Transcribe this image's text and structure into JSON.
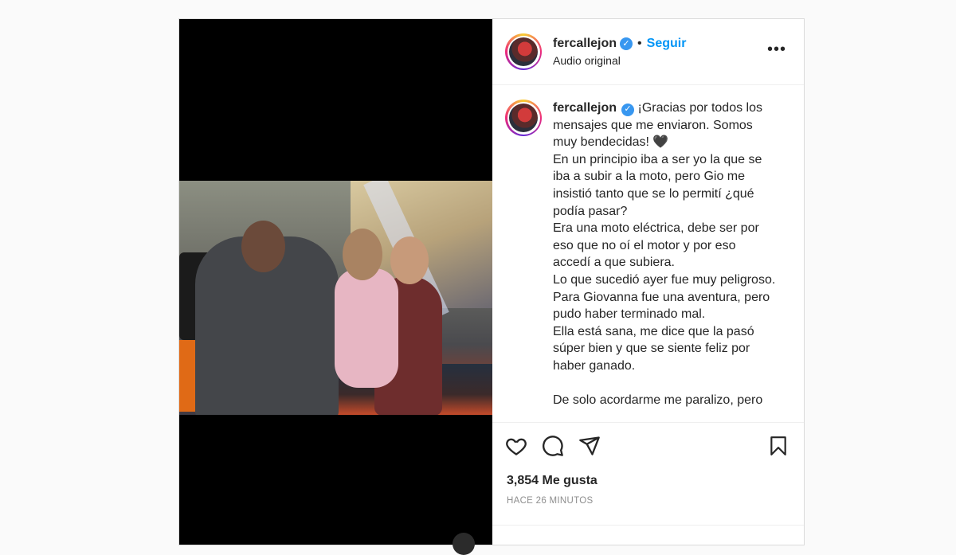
{
  "post": {
    "header": {
      "username": "fercallejon",
      "verified_icon": "verified-badge-icon",
      "separator": "•",
      "follow_label": "Seguir",
      "audio_label": "Audio original",
      "more_label": "•••"
    },
    "caption": {
      "username": "fercallejon",
      "lines": [
        "¡Gracias por todos los mensajes que me enviaron. Somos muy bendecidas! 🖤",
        "En un principio iba a ser yo la que se iba a subir a la moto, pero Gio me insistió tanto que se lo permití ¿qué podía pasar?",
        "Era una moto eléctrica, debe ser por eso que no oí el motor y por eso accedí a que subiera.",
        "Lo que sucedió ayer fue muy peligroso. Para Giovanna fue una aventura, pero pudo haber terminado mal.",
        "Ella está sana, me dice que la pasó súper bien y que se siente feliz por haber ganado.",
        "",
        "De solo acordarme me paralizo, pero"
      ]
    },
    "actions": {
      "like_icon": "heart-icon",
      "comment_icon": "comment-icon",
      "share_icon": "share-icon",
      "save_icon": "bookmark-icon"
    },
    "likes_text": "3,854 Me gusta",
    "time_text": "HACE 26 MINUTOS"
  },
  "colors": {
    "accent": "#0095f6",
    "verified": "#3897f0",
    "text": "#262626",
    "muted": "#8e8e8e"
  }
}
